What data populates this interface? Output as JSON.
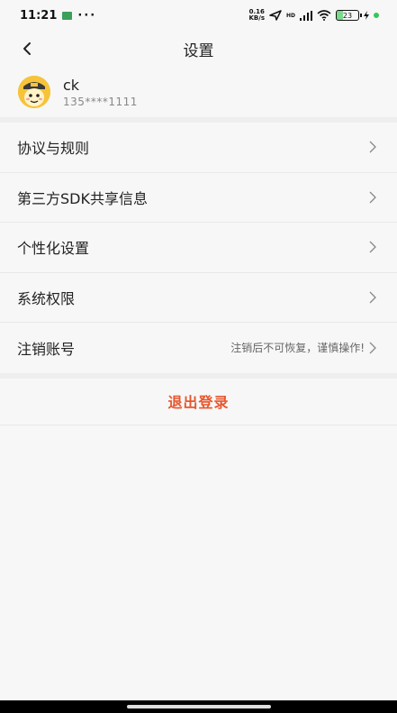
{
  "status_bar": {
    "time": "11:21",
    "dots": "···",
    "net_speed_value": "0.16",
    "net_speed_unit": "KB/s",
    "hd_label": "HD",
    "battery": "23"
  },
  "header": {
    "title": "设置"
  },
  "profile": {
    "name": "ck",
    "phone": "135****1111"
  },
  "menu": {
    "items": [
      {
        "label": "协议与规则",
        "hint": ""
      },
      {
        "label": "第三方SDK共享信息",
        "hint": ""
      },
      {
        "label": "个性化设置",
        "hint": ""
      },
      {
        "label": "系统权限",
        "hint": ""
      },
      {
        "label": "注销账号",
        "hint": "注销后不可恢复，谨慎操作!"
      }
    ]
  },
  "logout": {
    "label": "退出登录"
  },
  "colors": {
    "accent": "#e8562e",
    "background": "#f7f7f7",
    "avatar_bg": "#f6c33a"
  }
}
